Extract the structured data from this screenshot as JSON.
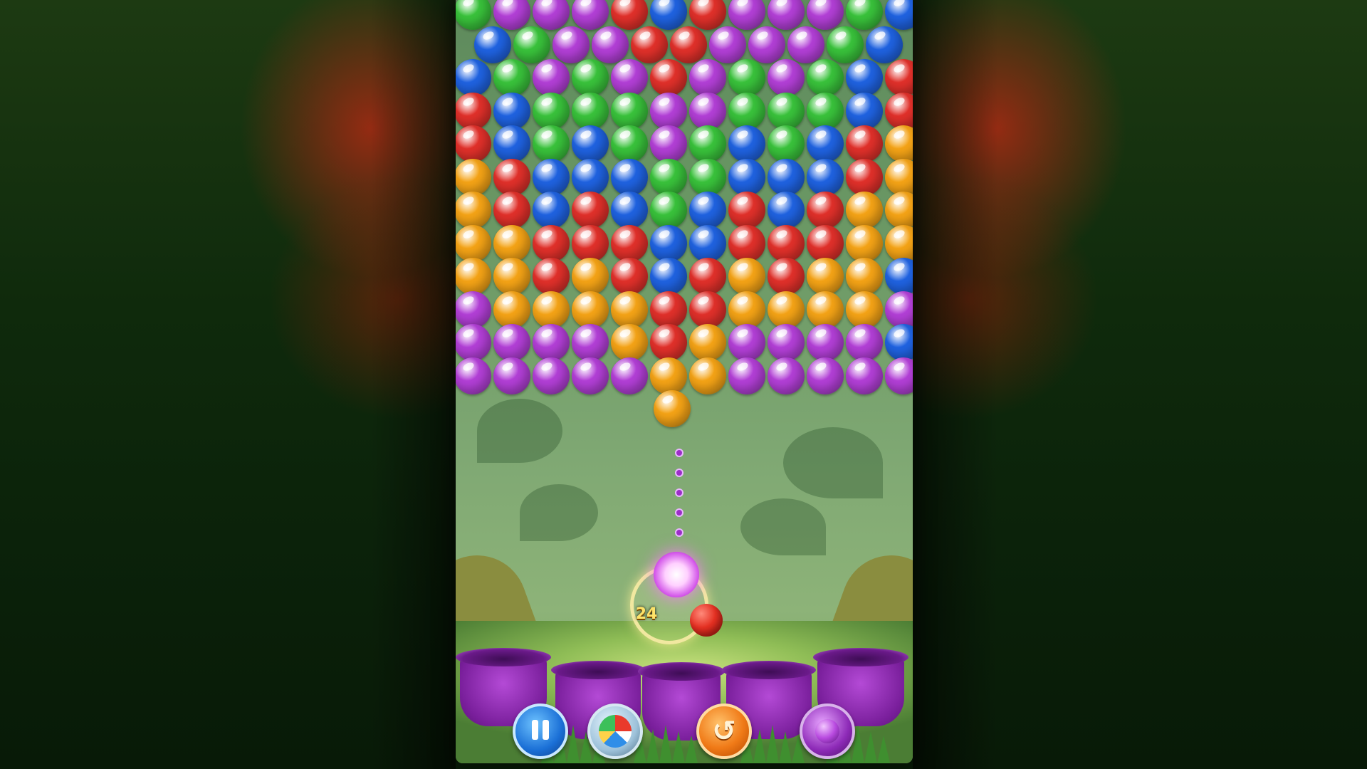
{
  "game": {
    "shots_remaining": "24"
  },
  "colors": {
    "green": "#39c23b",
    "purple": "#b23fd6",
    "red": "#e0302a",
    "blue": "#1f62e0",
    "yellow": "#f4a316",
    "current_bubble": "#f08cff",
    "next_bubble": "#e0302a",
    "aim_dots": "#9b2fc7"
  },
  "board_rows": [
    [
      "G",
      "P",
      "P",
      "P",
      "R",
      "B",
      "R",
      "P",
      "P",
      "P",
      "G",
      "B"
    ],
    [
      "B",
      "G",
      "P",
      "P",
      "R",
      "R",
      "P",
      "P",
      "P",
      "G",
      "B"
    ],
    [
      "B",
      "G",
      "P",
      "G",
      "P",
      "R",
      "P",
      "G",
      "P",
      "G",
      "B",
      "R"
    ],
    [
      "R",
      "B",
      "G",
      "G",
      "G",
      "P",
      "P",
      "G",
      "G",
      "G",
      "B",
      "R"
    ],
    [
      "R",
      "B",
      "G",
      "B",
      "G",
      "P",
      "G",
      "B",
      "G",
      "B",
      "R",
      "Y"
    ],
    [
      "Y",
      "R",
      "B",
      "B",
      "B",
      "G",
      "G",
      "B",
      "B",
      "B",
      "R",
      "Y"
    ],
    [
      "Y",
      "R",
      "B",
      "R",
      "B",
      "G",
      "B",
      "R",
      "B",
      "R",
      "Y",
      "Y"
    ],
    [
      "Y",
      "Y",
      "R",
      "R",
      "R",
      "B",
      "B",
      "R",
      "R",
      "R",
      "Y",
      "Y"
    ],
    [
      "Y",
      "Y",
      "R",
      "Y",
      "R",
      "B",
      "R",
      "Y",
      "R",
      "Y",
      "Y",
      "B"
    ],
    [
      "P",
      "Y",
      "Y",
      "Y",
      "Y",
      "R",
      "R",
      "Y",
      "Y",
      "Y",
      "Y",
      "P"
    ],
    [
      "P",
      "P",
      "P",
      "P",
      "Y",
      "R",
      "Y",
      "P",
      "P",
      "P",
      "P",
      "B"
    ],
    [
      "P",
      "P",
      "P",
      "P",
      "P",
      "Y",
      "Y",
      "P",
      "P",
      "P",
      "P",
      "P"
    ],
    [
      "",
      "",
      "",
      "",
      "",
      "Y",
      "",
      "",
      "",
      "",
      "",
      ""
    ]
  ],
  "controls": {
    "pause": {
      "icon": "pause-icon"
    },
    "ball_booster": {
      "icon": "beach-ball-icon"
    },
    "swap": {
      "icon": "swap-icon"
    },
    "bomb_booster": {
      "icon": "bomb-bubble-icon"
    }
  }
}
